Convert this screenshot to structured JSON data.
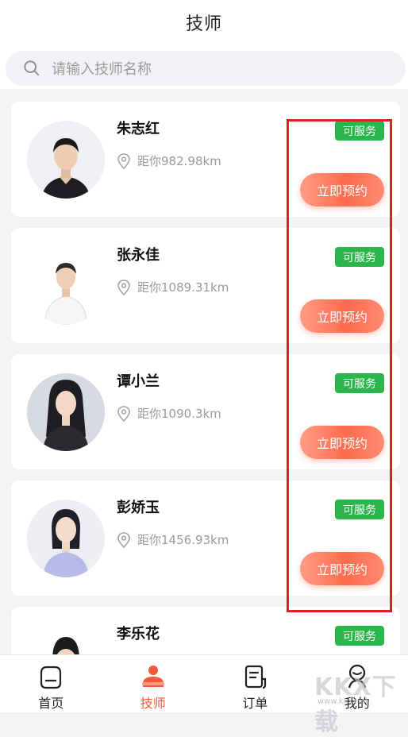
{
  "header": {
    "title": "技师"
  },
  "search": {
    "placeholder": "请输入技师名称",
    "value": ""
  },
  "technicians": [
    {
      "name": "朱志红",
      "distance": "距你982.98km",
      "status": "可服务",
      "action": "立即预约"
    },
    {
      "name": "张永佳",
      "distance": "距你1089.31km",
      "status": "可服务",
      "action": "立即预约"
    },
    {
      "name": "谭小兰",
      "distance": "距你1090.3km",
      "status": "可服务",
      "action": "立即预约"
    },
    {
      "name": "彭娇玉",
      "distance": "距你1456.93km",
      "status": "可服务",
      "action": "立即预约"
    },
    {
      "name": "李乐花",
      "status": "可服务"
    }
  ],
  "tabbar": {
    "items": [
      {
        "label": "首页",
        "icon": "home-icon"
      },
      {
        "label": "技师",
        "icon": "technician-icon",
        "active": true
      },
      {
        "label": "订单",
        "icon": "order-icon"
      },
      {
        "label": "我的",
        "icon": "profile-icon"
      }
    ]
  },
  "watermark": {
    "text": "KKX下载",
    "sub": "www.kkx.net"
  },
  "colors": {
    "accent": "#f05a3a",
    "badge_green": "#2bb64b",
    "highlight_red": "#e02020"
  }
}
